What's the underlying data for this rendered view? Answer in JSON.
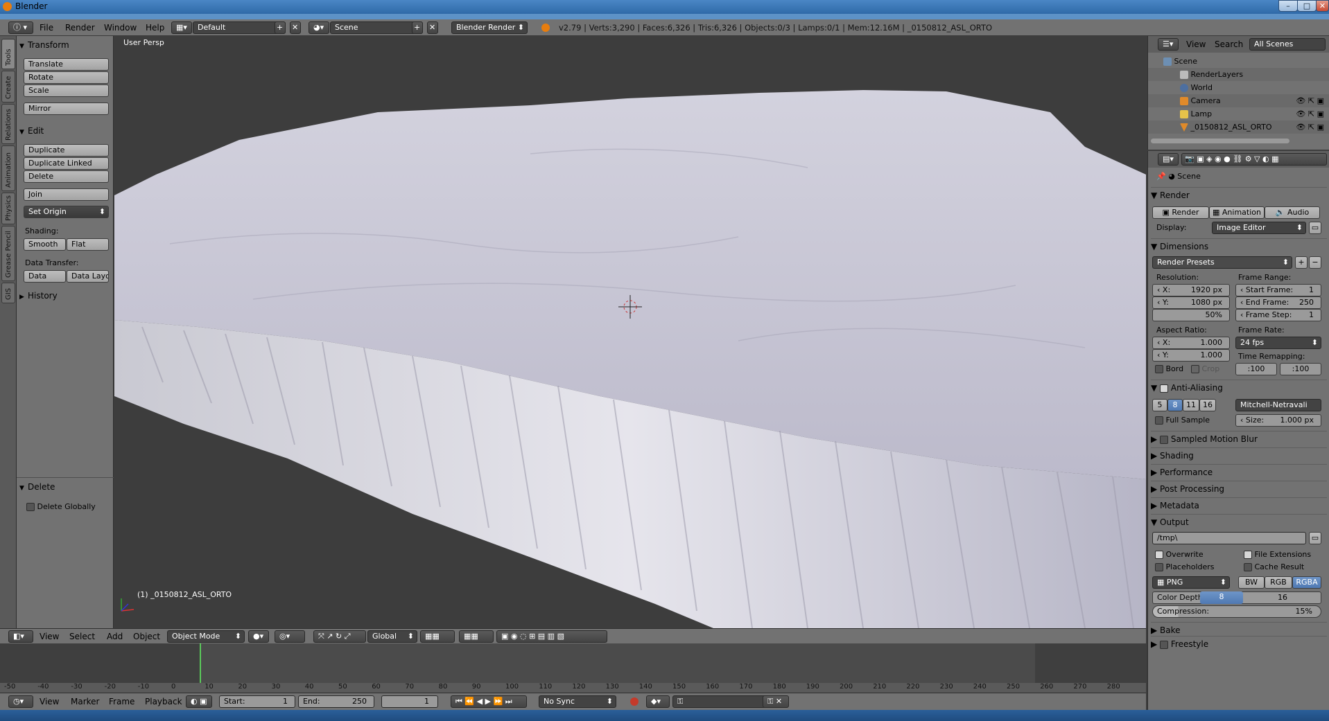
{
  "window": {
    "title": "Blender"
  },
  "info_header": {
    "menus": [
      "File",
      "Render",
      "Window",
      "Help"
    ],
    "layout": "Default",
    "scene": "Scene",
    "engine": "Blender Render",
    "stats": "v2.79 | Verts:3,290 | Faces:6,326 | Tris:6,326 | Objects:0/3 | Lamps:0/1 | Mem:12.16M | _0150812_ASL_ORTO"
  },
  "tabs": [
    "Tools",
    "Create",
    "Relations",
    "Animation",
    "Physics",
    "Grease Pencil",
    "GIS"
  ],
  "toolshelf": {
    "transform": {
      "title": "Transform",
      "buttons": [
        "Translate",
        "Rotate",
        "Scale"
      ],
      "mirror": "Mirror"
    },
    "edit": {
      "title": "Edit",
      "buttons": [
        "Duplicate",
        "Duplicate Linked",
        "Delete"
      ],
      "join": "Join",
      "set_origin": "Set Origin",
      "shading_label": "Shading:",
      "smooth": "Smooth",
      "flat": "Flat",
      "data_transfer_label": "Data Transfer:",
      "data": "Data",
      "data_layo": "Data Layo"
    },
    "history": "History",
    "operator": {
      "title": "Delete",
      "option": "Delete Globally"
    }
  },
  "viewport": {
    "label": "User Persp",
    "object_label": "(1) _0150812_ASL_ORTO",
    "header": {
      "menus": [
        "View",
        "Select",
        "Add",
        "Object"
      ],
      "mode": "Object Mode",
      "orientation": "Global"
    }
  },
  "timeline": {
    "ticks": [
      "-50",
      "-40",
      "-30",
      "-20",
      "-10",
      "0",
      "10",
      "20",
      "30",
      "40",
      "50",
      "60",
      "70",
      "80",
      "90",
      "100",
      "110",
      "120",
      "130",
      "140",
      "150",
      "160",
      "170",
      "180",
      "190",
      "200",
      "210",
      "220",
      "230",
      "240",
      "250",
      "260",
      "270",
      "280"
    ],
    "menus": [
      "View",
      "Marker",
      "Frame",
      "Playback"
    ],
    "start_label": "Start:",
    "start": "1",
    "end_label": "End:",
    "end": "250",
    "current": "1",
    "sync": "No Sync"
  },
  "outliner": {
    "header": {
      "view": "View",
      "search": "Search",
      "filter": "All Scenes"
    },
    "items": [
      "Scene",
      "RenderLayers",
      "World",
      "Camera",
      "Lamp",
      "_0150812_ASL_ORTO"
    ]
  },
  "properties": {
    "context": "Scene",
    "render": {
      "title": "Render",
      "render": "Render",
      "animation": "Animation",
      "audio": "Audio",
      "display_label": "Display:",
      "display": "Image Editor"
    },
    "dimensions": {
      "title": "Dimensions",
      "presets": "Render Presets",
      "resolution_label": "Resolution:",
      "res_x": "1920 px",
      "res_y": "1080 px",
      "res_pct": "50%",
      "x_label": "X:",
      "y_label": "Y:",
      "frame_range_label": "Frame Range:",
      "start_frame": "1",
      "end_frame": "250",
      "frame_step": "1",
      "start_frame_label": "Start Frame:",
      "end_frame_label": "End Frame:",
      "frame_step_label": "Frame Step:",
      "aspect_label": "Aspect Ratio:",
      "aspect_x": "1.000",
      "aspect_y": "1.000",
      "frame_rate_label": "Frame Rate:",
      "frame_rate": "24 fps",
      "bord": "Bord",
      "crop": "Crop",
      "time_remap_label": "Time Remapping:",
      "remap_old": ":100",
      "remap_new": ":100"
    },
    "aa": {
      "title": "Anti-Aliasing",
      "samples": [
        "5",
        "8",
        "11",
        "16"
      ],
      "selected": "8",
      "filter": "Mitchell-Netravali",
      "full_sample": "Full Sample",
      "size_label": "Size:",
      "size": "1.000 px"
    },
    "collapsed": [
      "Sampled Motion Blur",
      "Shading",
      "Performance",
      "Post Processing",
      "Metadata"
    ],
    "output": {
      "title": "Output",
      "path": "/tmp\\",
      "overwrite": "Overwrite",
      "file_ext": "File Extensions",
      "placeholders": "Placeholders",
      "cache": "Cache Result",
      "format": "PNG",
      "bw": "BW",
      "rgb": "RGB",
      "rgba": "RGBA",
      "depth_label": "Color Depth:",
      "depth_8": "8",
      "depth_16": "16",
      "compression_label": "Compression:",
      "compression": "15%"
    },
    "bake": "Bake",
    "freestyle": "Freestyle"
  }
}
